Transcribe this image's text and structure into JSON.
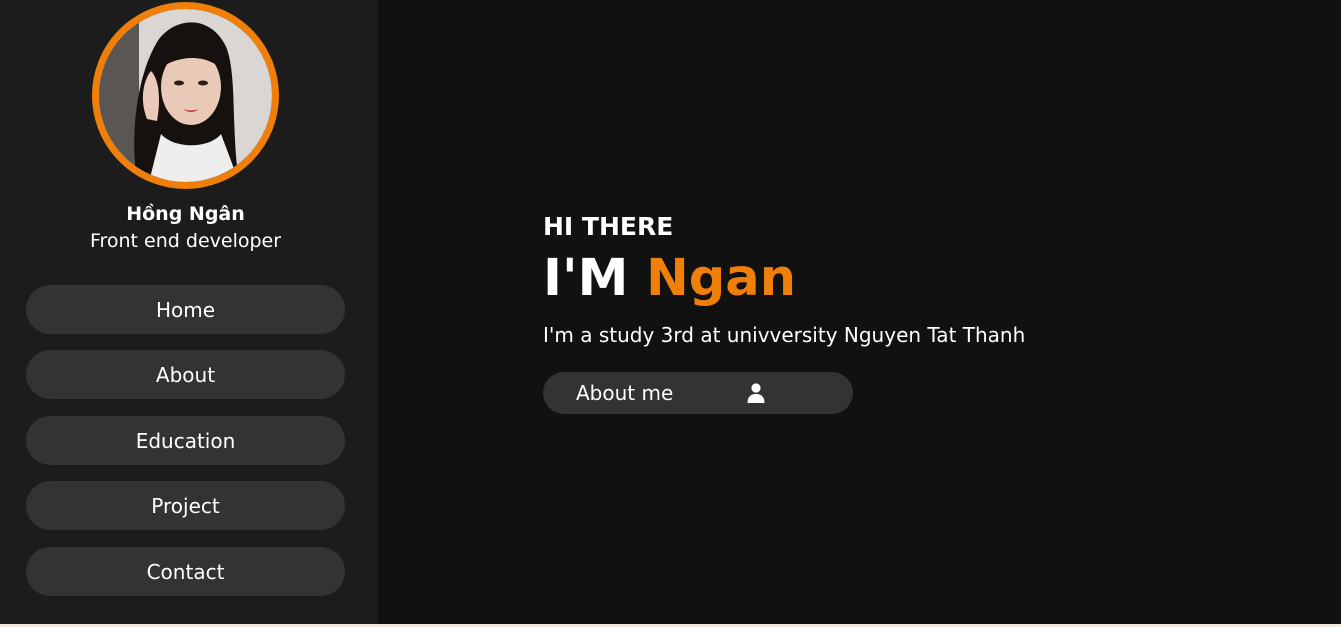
{
  "profile": {
    "name": "Hồng Ngân",
    "role": "Front end developer"
  },
  "nav": {
    "items": [
      {
        "label": "Home"
      },
      {
        "label": "About"
      },
      {
        "label": "Education"
      },
      {
        "label": "Project"
      },
      {
        "label": "Contact"
      }
    ]
  },
  "hero": {
    "greeting": "HI THERE",
    "headline_prefix": "I'M",
    "headline_name": "Ngan",
    "description": "I'm a study 3rd at univversity Nguyen Tat Thanh",
    "cta_label": "About me",
    "cta_icon": "user-icon"
  },
  "colors": {
    "accent": "#f07f0a",
    "background": "#111111",
    "sidebar": "#1c1c1c",
    "button": "#333333"
  }
}
